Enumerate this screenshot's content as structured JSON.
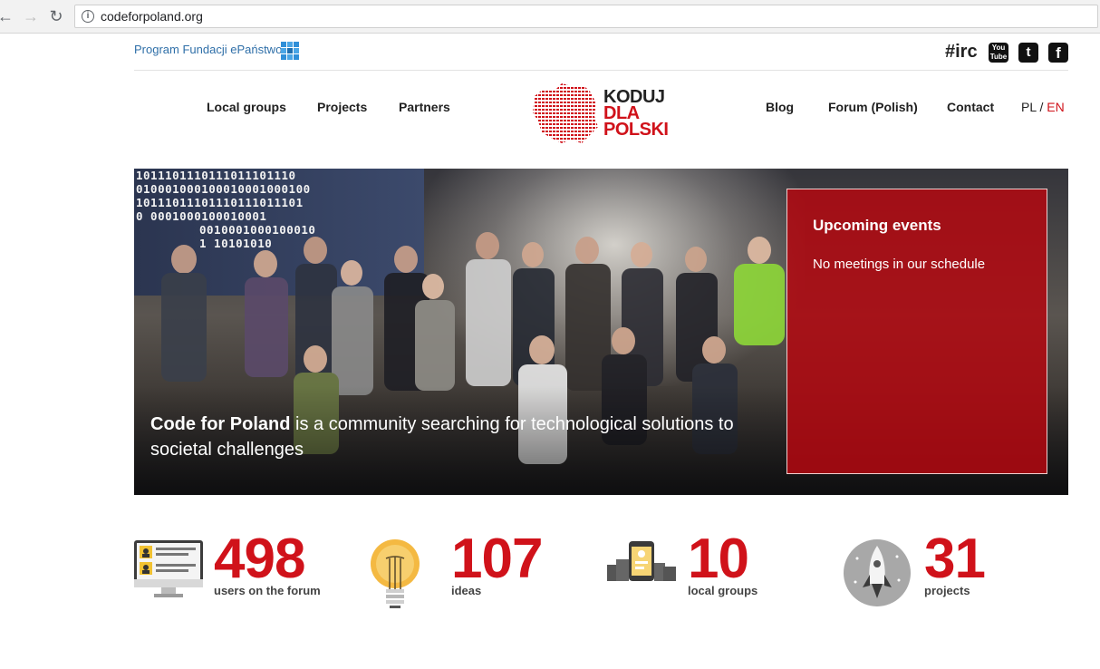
{
  "browser": {
    "url": "codeforpoland.org"
  },
  "topbar": {
    "program": "Program Fundacji ePaństwo",
    "irc": "#irc",
    "youtube": "You Tube",
    "twitter": "t",
    "facebook": "f"
  },
  "nav": {
    "left": [
      "Local groups",
      "Projects",
      "Partners"
    ],
    "right": [
      "Blog",
      "Forum (Polish)",
      "Contact"
    ],
    "lang_pl": "PL",
    "lang_sep": " / ",
    "lang_en": "EN"
  },
  "logo": {
    "line1": "KODUJ",
    "line2": "DLA",
    "line3": "POLSKI"
  },
  "hero": {
    "binary": [
      "1011101110111011101110",
      "010001000100010001000100",
      "10111011101110111011101",
      "0 0001000100010001",
      "0010001000100010",
      "1 10101010"
    ],
    "caption_bold": "Code for Poland",
    "caption_rest": " is a community searching for technological solutions to societal challenges"
  },
  "events": {
    "title": "Upcoming events",
    "message": "No meetings in our schedule"
  },
  "stats": [
    {
      "value": "498",
      "label": "users on the forum",
      "icon": "monitor-users-icon"
    },
    {
      "value": "107",
      "label": "ideas",
      "icon": "lightbulb-icon"
    },
    {
      "value": "10",
      "label": "local groups",
      "icon": "city-phone-icon"
    },
    {
      "value": "31",
      "label": "projects",
      "icon": "rocket-icon"
    }
  ],
  "colors": {
    "accent": "#d0121a",
    "link": "#2f6fa8"
  }
}
